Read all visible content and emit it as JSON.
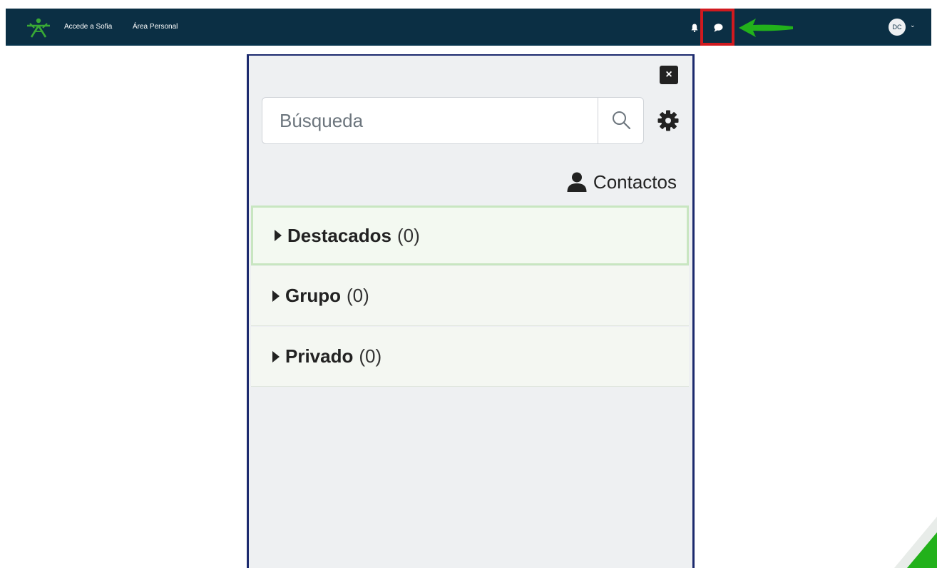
{
  "navbar": {
    "links": [
      "Accede a Sofia",
      "Área Personal"
    ],
    "avatar_initials": "DC",
    "avatar_caret": "⌄",
    "bg_color": "#0b2f44",
    "highlight_color": "#d01a1f",
    "arrow_color": "#22b11b"
  },
  "drawer": {
    "close_label": "×",
    "search": {
      "placeholder": "Búsqueda",
      "value": ""
    },
    "contacts_label": "Contactos",
    "sections": [
      {
        "label": "Destacados",
        "count": "(0)"
      },
      {
        "label": "Grupo",
        "count": "(0)"
      },
      {
        "label": "Privado",
        "count": "(0)"
      }
    ]
  }
}
